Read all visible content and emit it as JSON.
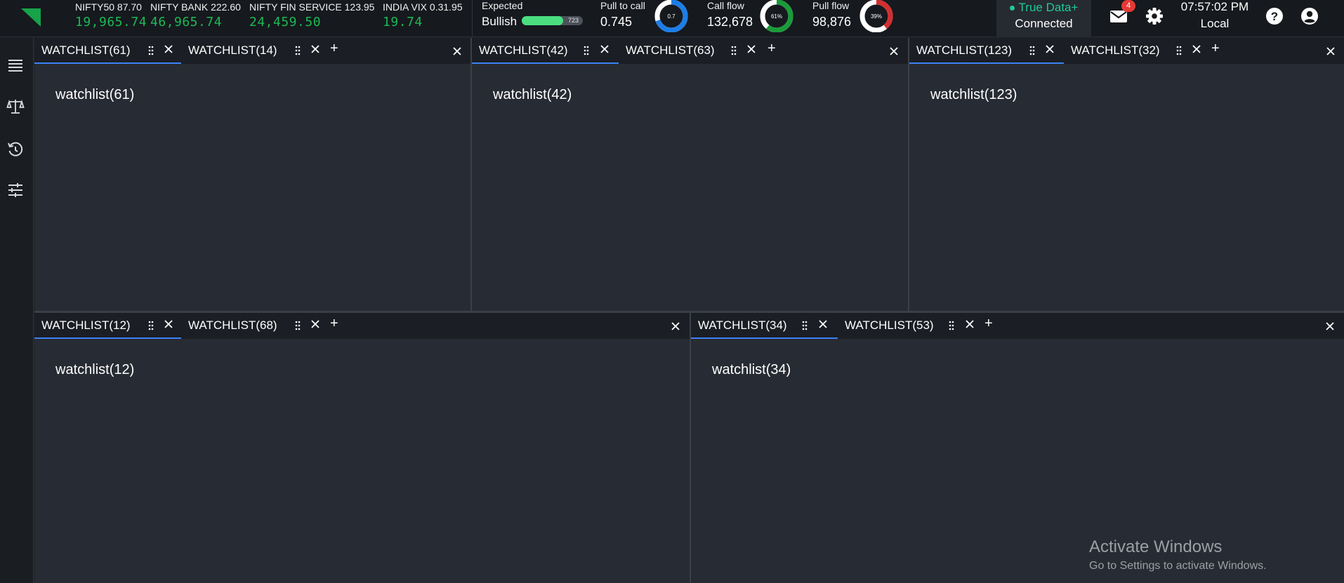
{
  "tickers": [
    {
      "name": "NIFTY50 87.70",
      "value": "19,965.74"
    },
    {
      "name": "NIFTY BANK 222.60",
      "value": "46,965.74"
    },
    {
      "name": "NIFTY FIN SERVICE 123.95",
      "value": "24,459.50"
    },
    {
      "name": "INDIA VIX 0.31.95",
      "value": "19.74"
    }
  ],
  "sentiment": {
    "label": "Expected",
    "value": "Bullish",
    "bar_value": "723",
    "bar_fraction": 0.68
  },
  "pull_to_call": {
    "label": "Pull to call",
    "value": "0.745",
    "donut_text": "0.7",
    "donut_fraction": 0.7,
    "donut_color": "#1e7de6"
  },
  "call_flow": {
    "label": "Call flow",
    "value": "132,678",
    "donut_text": "61%",
    "donut_fraction": 0.61,
    "donut_color": "#1a9b3a"
  },
  "pull_flow": {
    "label": "Pull flow",
    "value": "98,876",
    "donut_text": "39%",
    "donut_fraction": 0.39,
    "donut_color": "#d32f2f"
  },
  "connection": {
    "provider": "True Data+",
    "status": "Connected",
    "color": "#20c997"
  },
  "notifications": {
    "count": "4"
  },
  "clock": {
    "time": "07:57:02 PM",
    "zone": "Local"
  },
  "panels": [
    {
      "tabs": [
        {
          "label": "WATCHLIST(61)"
        },
        {
          "label": "WATCHLIST(14)"
        }
      ],
      "content": "watchlist(61)"
    },
    {
      "tabs": [
        {
          "label": "WATCHLIST(42)"
        },
        {
          "label": "WATCHLIST(63)"
        }
      ],
      "content": "watchlist(42)"
    },
    {
      "tabs": [
        {
          "label": "WATCHLIST(123)"
        },
        {
          "label": "WATCHLIST(32)"
        }
      ],
      "content": "watchlist(123)"
    },
    {
      "tabs": [
        {
          "label": "WATCHLIST(12)"
        },
        {
          "label": "WATCHLIST(68)"
        }
      ],
      "content": "watchlist(12)"
    },
    {
      "tabs": [
        {
          "label": "WATCHLIST(34)"
        },
        {
          "label": "WATCHLIST(53)"
        }
      ],
      "content": "watchlist(34)"
    }
  ],
  "watermark": {
    "line1": "Activate Windows",
    "line2": "Go to Settings to activate Windows."
  },
  "colors": {
    "accent": "#3b82f6",
    "up": "#1db954",
    "brand": "#16a34a"
  }
}
